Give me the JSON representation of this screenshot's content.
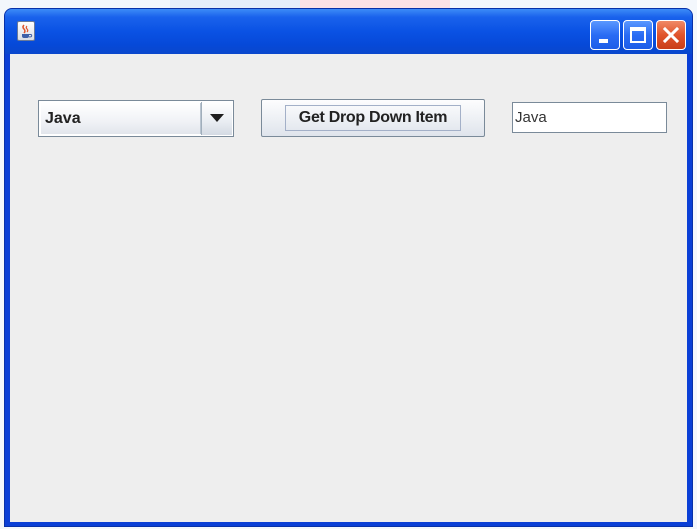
{
  "window": {
    "title": "",
    "icon": "java-coffee-cup-icon"
  },
  "title_buttons": {
    "minimize_icon": "minimize-icon",
    "maximize_icon": "maximize-icon",
    "close_icon": "close-icon"
  },
  "form": {
    "dropdown": {
      "selected": "Java",
      "arrow_icon": "chevron-down-icon"
    },
    "get_button_label": "Get Drop Down Item",
    "result_field_value": "Java"
  },
  "colors": {
    "titlebar": "#0a52e4",
    "close_button": "#e0542c",
    "client_background": "#eeeeee"
  }
}
